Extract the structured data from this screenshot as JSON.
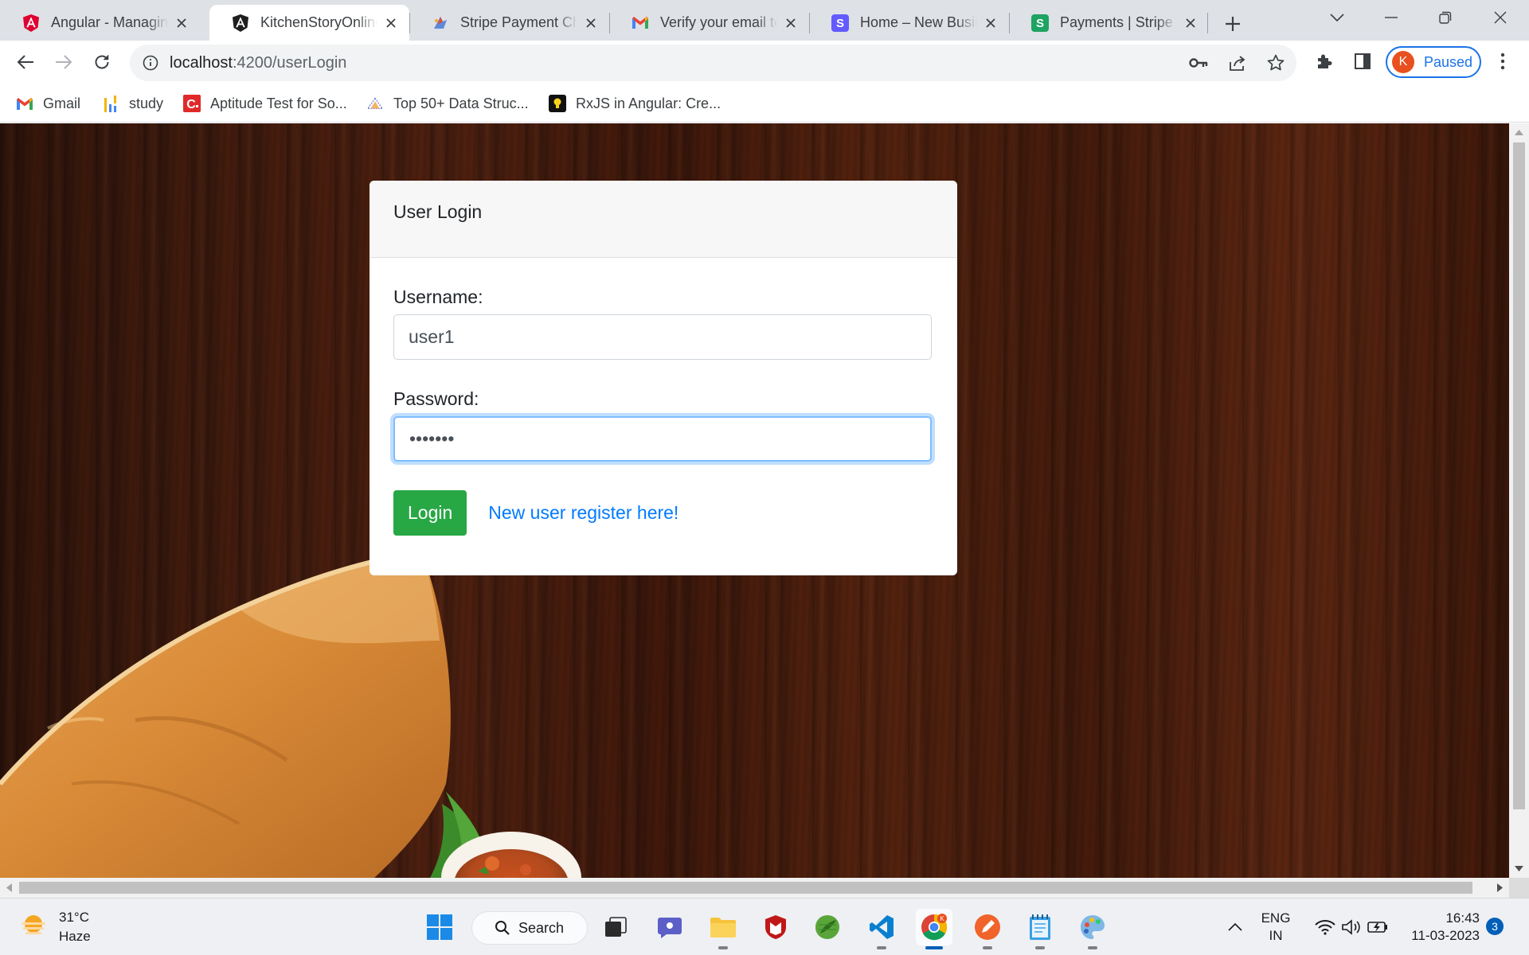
{
  "browser": {
    "tabs": [
      {
        "title": "Angular - Managing",
        "favicon": "angular-red-icon"
      },
      {
        "title": "KitchenStoryOnline",
        "favicon": "angular-black-icon",
        "active": true
      },
      {
        "title": "Stripe Payment Che",
        "favicon": "stripe-checkout-icon"
      },
      {
        "title": "Verify your email to",
        "favicon": "gmail-icon"
      },
      {
        "title": "Home – New Busin",
        "favicon": "stripe-s-icon"
      },
      {
        "title": "Payments | Stripe D",
        "favicon": "stripe-green-s-icon"
      }
    ],
    "url_host": "localhost",
    "url_path": ":4200/userLogin",
    "profile_initial": "K",
    "profile_label": "Paused",
    "bookmarks": [
      {
        "label": "Gmail",
        "icon": "gmail-icon"
      },
      {
        "label": "study",
        "icon": "bar-chart-icon"
      },
      {
        "label": "Aptitude Test for So...",
        "icon": "c-logo-icon"
      },
      {
        "label": "Top 50+ Data Struc...",
        "icon": "pyramid-icon"
      },
      {
        "label": "RxJS in Angular: Cre...",
        "icon": "bulb-icon"
      }
    ]
  },
  "login": {
    "header": "User Login",
    "username_label": "Username:",
    "username_value": "user1",
    "password_label": "Password:",
    "password_value": "•••••••",
    "login_button": "Login",
    "register_link": "New user register here!"
  },
  "taskbar": {
    "weather_temp": "31°C",
    "weather_desc": "Haze",
    "search_label": "Search",
    "lang_top": "ENG",
    "lang_bottom": "IN",
    "time": "16:43",
    "date": "11-03-2023",
    "notification_count": "3"
  },
  "colors": {
    "accent": "#1a73e8",
    "login_button": "#28a745",
    "link": "#007bff",
    "focus_ring": "#80bdff"
  }
}
